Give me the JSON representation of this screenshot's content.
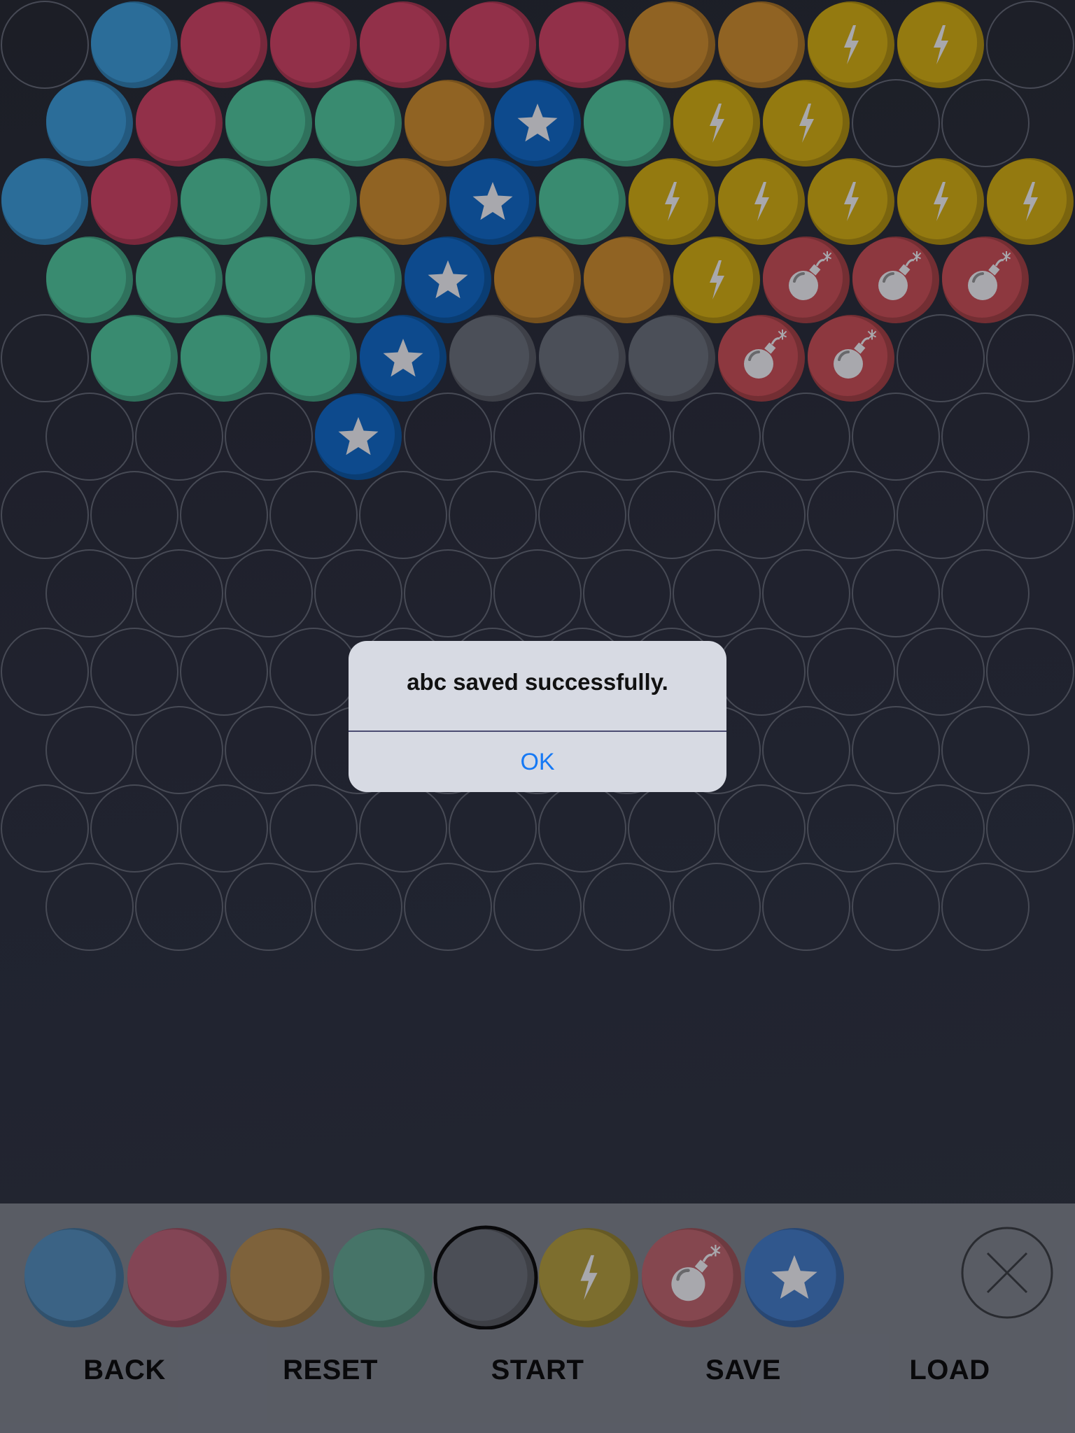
{
  "board": {
    "rows": [
      [
        "empty",
        "blue",
        "red",
        "red",
        "red",
        "red",
        "red",
        "orange",
        "orange",
        "lightning",
        "lightning",
        "empty"
      ],
      [
        "blue",
        "red",
        "green",
        "green",
        "orange",
        "star",
        "green",
        "lightning",
        "lightning",
        "empty",
        "empty"
      ],
      [
        "blue",
        "red",
        "green",
        "green",
        "orange",
        "star",
        "green",
        "lightning",
        "lightning",
        "lightning",
        "lightning",
        "lightning"
      ],
      [
        "green",
        "green",
        "green",
        "green",
        "star",
        "orange",
        "orange",
        "lightning",
        "bomb",
        "bomb",
        "bomb"
      ],
      [
        "empty",
        "green",
        "green",
        "green",
        "star",
        "gray",
        "gray",
        "gray",
        "bomb",
        "bomb",
        "empty",
        "empty"
      ],
      [
        "empty",
        "empty",
        "empty",
        "star",
        "empty",
        "empty",
        "empty",
        "empty",
        "empty",
        "empty",
        "empty"
      ],
      [
        "empty",
        "empty",
        "empty",
        "empty",
        "empty",
        "empty",
        "empty",
        "empty",
        "empty",
        "empty",
        "empty",
        "empty"
      ],
      [
        "empty",
        "empty",
        "empty",
        "empty",
        "empty",
        "empty",
        "empty",
        "empty",
        "empty",
        "empty",
        "empty"
      ],
      [
        "empty",
        "empty",
        "empty",
        "empty",
        "empty",
        "empty",
        "empty",
        "empty",
        "empty",
        "empty",
        "empty",
        "empty"
      ],
      [
        "empty",
        "empty",
        "empty",
        "empty",
        "empty",
        "empty",
        "empty",
        "empty",
        "empty",
        "empty",
        "empty"
      ],
      [
        "empty",
        "empty",
        "empty",
        "empty",
        "empty",
        "empty",
        "empty",
        "empty",
        "empty",
        "empty",
        "empty",
        "empty"
      ],
      [
        "empty",
        "empty",
        "empty",
        "empty",
        "empty",
        "empty",
        "empty",
        "empty",
        "empty",
        "empty",
        "empty"
      ]
    ]
  },
  "bubble_colors": {
    "blue": "#2e74a3",
    "red": "#9c344e",
    "orange": "#9a6a26",
    "green": "#3d9478",
    "gray": "#50545e",
    "lightning": "#9e8212",
    "bomb": "#963c43",
    "star": "#0e4f96",
    "symbol": "#b3b3b8",
    "empty_stroke": "#4c4f5b"
  },
  "palette": {
    "items": [
      "blue",
      "red",
      "orange",
      "green",
      "gray",
      "lightning",
      "bomb",
      "star"
    ],
    "selected": "gray",
    "colors": {
      "blue": "#3f6a8e",
      "red": "#8c4a5b",
      "orange": "#86693f",
      "green": "#4b7c6f",
      "gray": "#50535c",
      "lightning": "#857531",
      "bomb": "#8e4c54",
      "star": "#345d96"
    },
    "close_icon": "close-icon"
  },
  "menu": {
    "back": "BACK",
    "reset": "RESET",
    "start": "START",
    "save": "SAVE",
    "load": "LOAD"
  },
  "dialog": {
    "message": "abc saved successfully.",
    "ok": "OK"
  }
}
